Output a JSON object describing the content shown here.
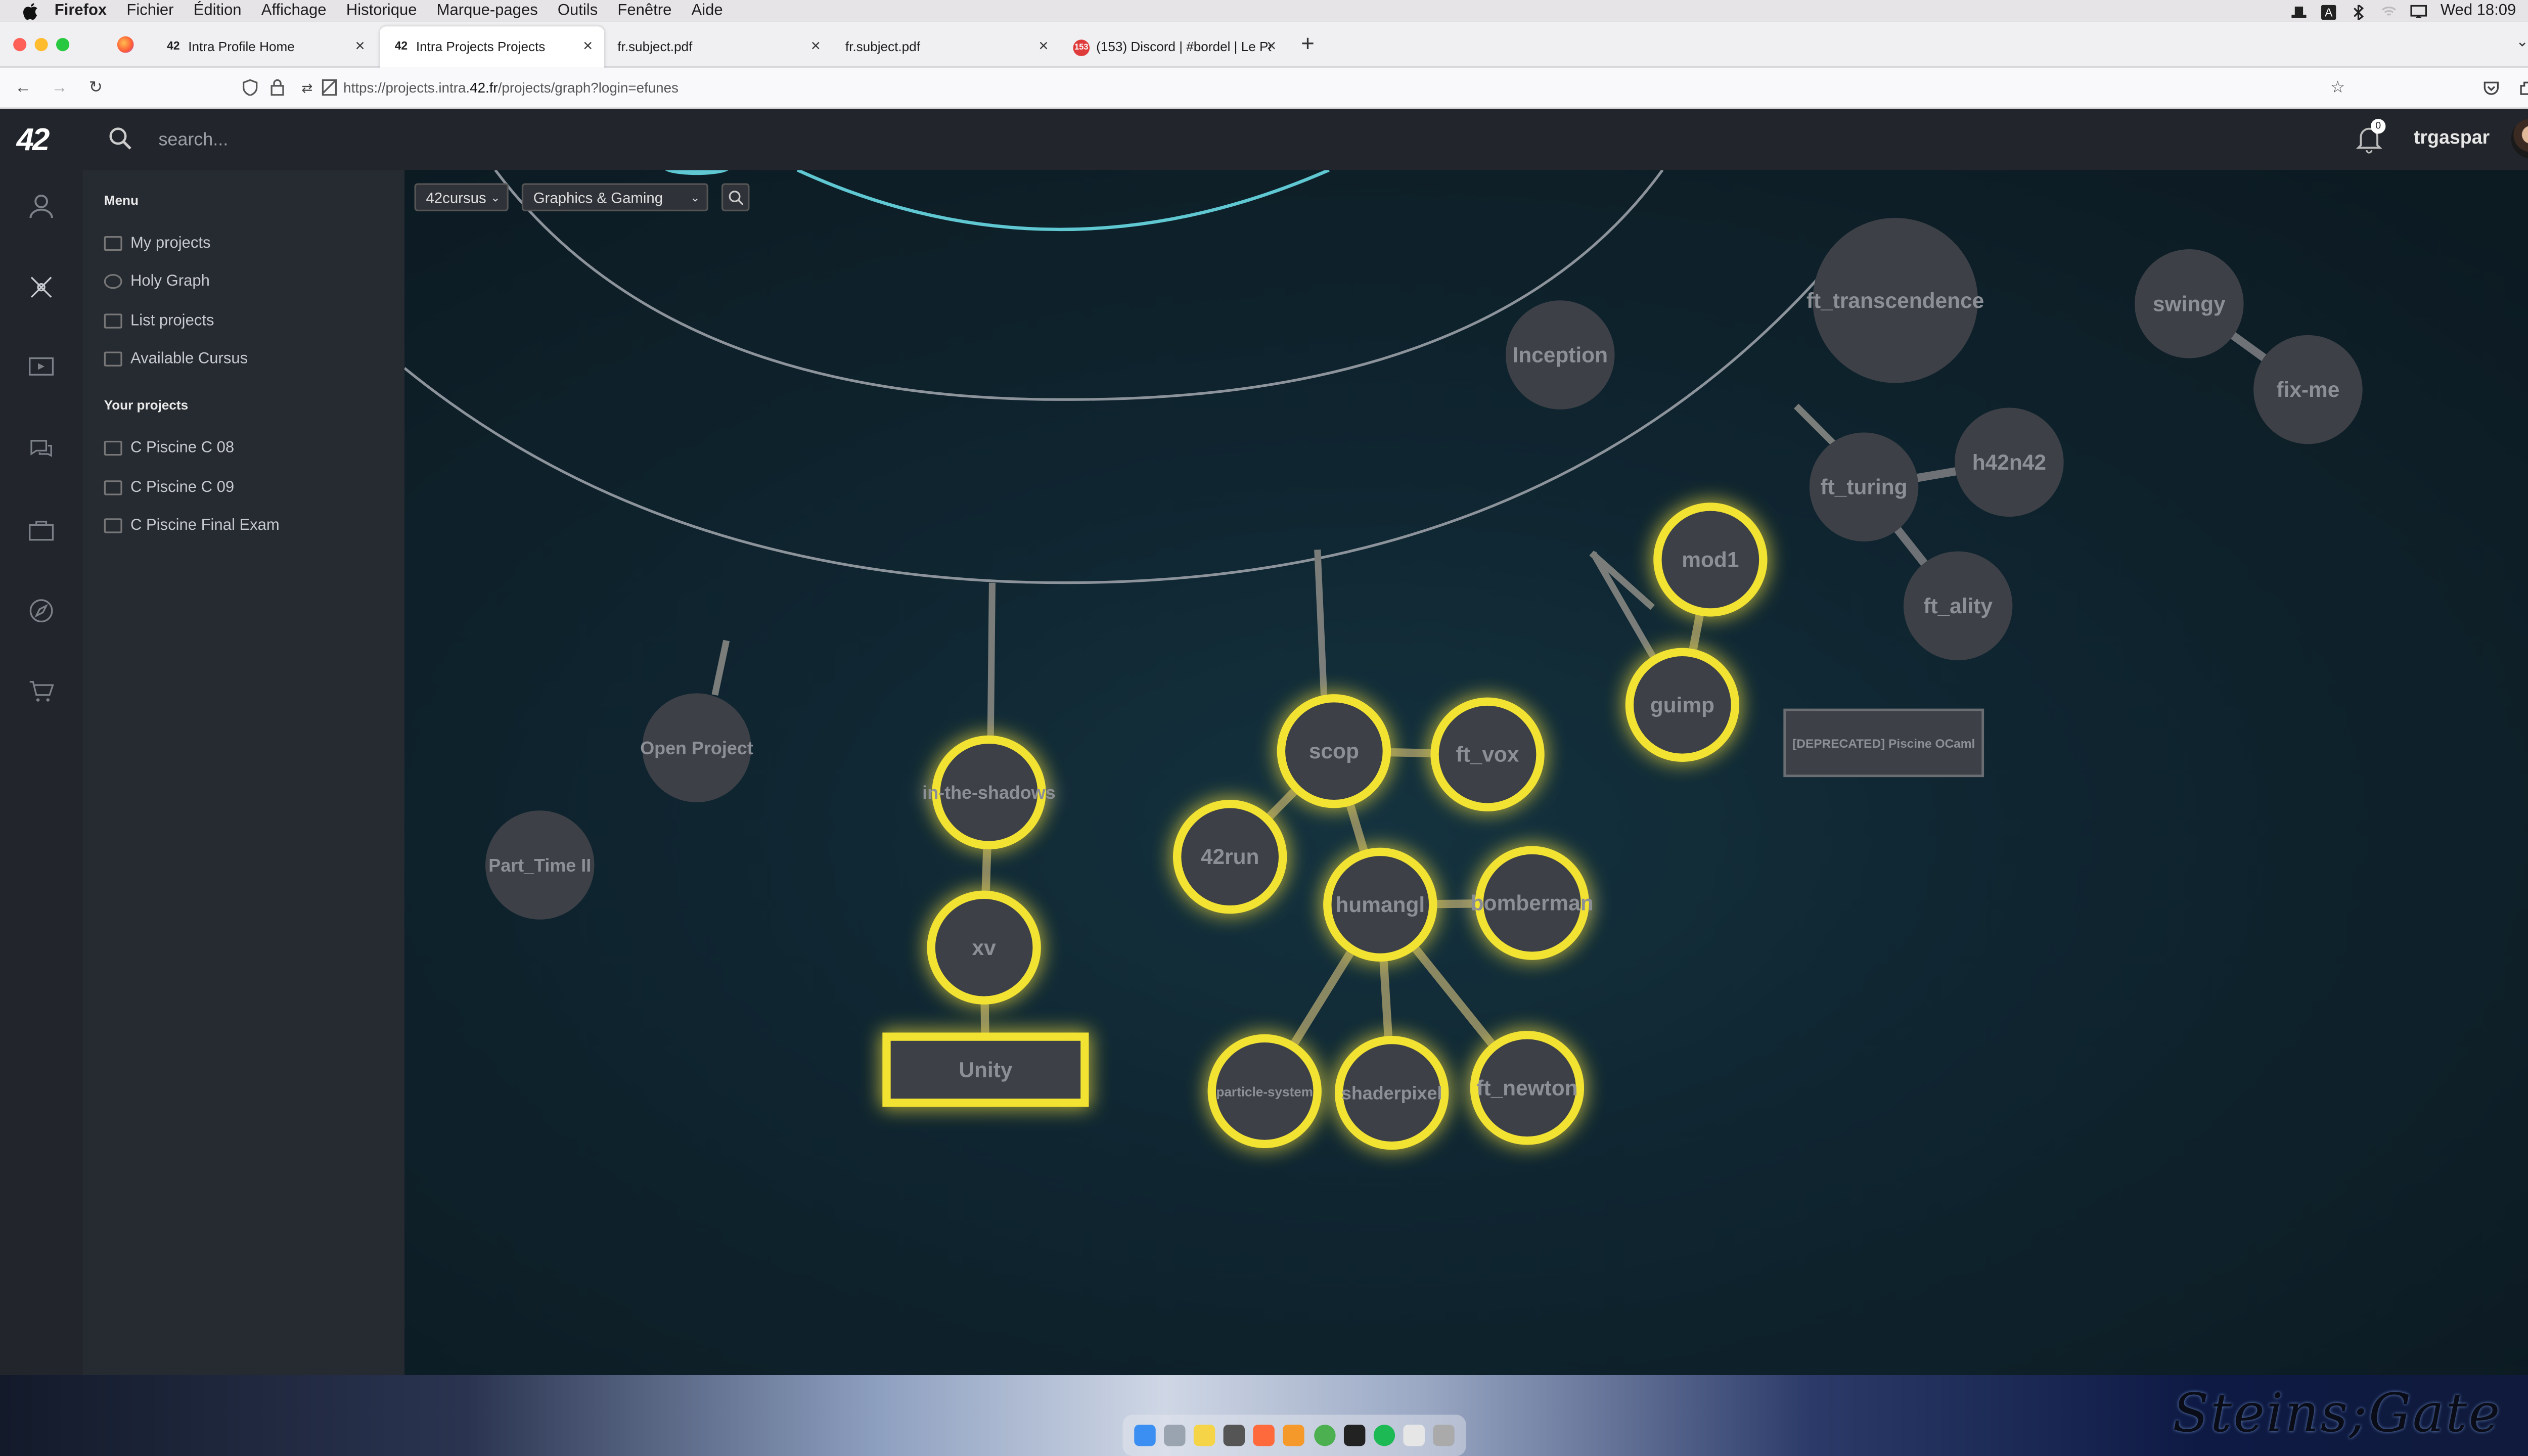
{
  "menubar": {
    "app_name": "Firefox",
    "items": [
      "Fichier",
      "Édition",
      "Affichage",
      "Historique",
      "Marque-pages",
      "Outils",
      "Fenêtre",
      "Aide"
    ],
    "clock": "Wed 18:09",
    "status_icons": [
      "hat-icon",
      "keyboard-input-icon",
      "bluetooth-icon",
      "wifi-icon",
      "airplay-icon",
      "spotlight-icon"
    ]
  },
  "tabs": [
    {
      "label": "Intra Profile Home",
      "favicon": "42-favicon",
      "active": false
    },
    {
      "label": "Intra Projects Projects",
      "favicon": "42-favicon",
      "active": true
    },
    {
      "label": "fr.subject.pdf",
      "favicon": "",
      "active": false
    },
    {
      "label": "fr.subject.pdf",
      "favicon": "",
      "active": false
    },
    {
      "label": "(153) Discord | #bordel | Le Par",
      "favicon": "discord-favicon",
      "active": false
    }
  ],
  "navbar": {
    "url_prefix": "https://projects.intra.",
    "url_domain": "42.fr",
    "url_suffix": "/projects/graph?login=efunes"
  },
  "topbar": {
    "logo": "42",
    "search_placeholder": "search...",
    "notifications_count": "0",
    "username": "trgaspar"
  },
  "sidebar": {
    "menu_heading": "Menu",
    "menu_items": [
      "My projects",
      "Holy Graph",
      "List projects",
      "Available Cursus"
    ],
    "projects_heading": "Your projects",
    "project_items": [
      "C Piscine C 08",
      "C Piscine C 09",
      "C Piscine Final Exam"
    ],
    "rail_icons": [
      "profile-icon",
      "graph-icon",
      "elearning-icon",
      "forum-icon",
      "companies-icon",
      "compass-icon",
      "shop-icon"
    ]
  },
  "filters": {
    "cursus": "42cursus",
    "category": "Graphics & Gaming"
  },
  "graph": {
    "nodes": [
      {
        "label": "Inception",
        "status": "default"
      },
      {
        "label": "ft_transcendence",
        "status": "default"
      },
      {
        "label": "swingy",
        "status": "default"
      },
      {
        "label": "fix-me",
        "status": "default"
      },
      {
        "label": "ft_turing",
        "status": "default"
      },
      {
        "label": "h42n42",
        "status": "default"
      },
      {
        "label": "ft_ality",
        "status": "default"
      },
      {
        "label": "mod1",
        "status": "available"
      },
      {
        "label": "guimp",
        "status": "available"
      },
      {
        "label": "[DEPRECATED] Piscine OCaml",
        "status": "default"
      },
      {
        "label": "Open Project",
        "status": "default"
      },
      {
        "label": "Part_Time II",
        "status": "default"
      },
      {
        "label": "in-the-shadows",
        "status": "available"
      },
      {
        "label": "xv",
        "status": "available"
      },
      {
        "label": "Unity",
        "status": "available"
      },
      {
        "label": "scop",
        "status": "available"
      },
      {
        "label": "ft_vox",
        "status": "available"
      },
      {
        "label": "42run",
        "status": "available"
      },
      {
        "label": "humangl",
        "status": "available"
      },
      {
        "label": "bomberman",
        "status": "available"
      },
      {
        "label": "particle-system",
        "status": "available"
      },
      {
        "label": "shaderpixel",
        "status": "available"
      },
      {
        "label": "ft_newton",
        "status": "available"
      }
    ],
    "edges": [
      [
        "ft_turing",
        "h42n42"
      ],
      [
        "ft_turing",
        "ft_ality"
      ],
      [
        "swingy",
        "fix-me"
      ],
      [
        "mod1",
        "guimp"
      ],
      [
        "in-the-shadows",
        "xv"
      ],
      [
        "xv",
        "Unity"
      ],
      [
        "scop",
        "ft_vox"
      ],
      [
        "scop",
        "42run"
      ],
      [
        "scop",
        "humangl"
      ],
      [
        "humangl",
        "bomberman"
      ],
      [
        "humangl",
        "particle-system"
      ],
      [
        "humangl",
        "shaderpixel"
      ],
      [
        "humangl",
        "ft_newton"
      ]
    ],
    "available_color": "#f2e233",
    "default_node_color": "#3d4046",
    "ring_color": "#8d939b",
    "inner_ring_color": "#5fc8d2"
  },
  "desktop": {
    "wallpaper_text": "Steins;Gate",
    "dock_apps": [
      "finder-icon",
      "launchpad-icon",
      "notes-icon",
      "screenshot-icon",
      "firefox-icon",
      "sublime-icon",
      "chrome-icon",
      "terminal-icon",
      "spotify-icon",
      "files-icon",
      "trash-icon"
    ]
  }
}
